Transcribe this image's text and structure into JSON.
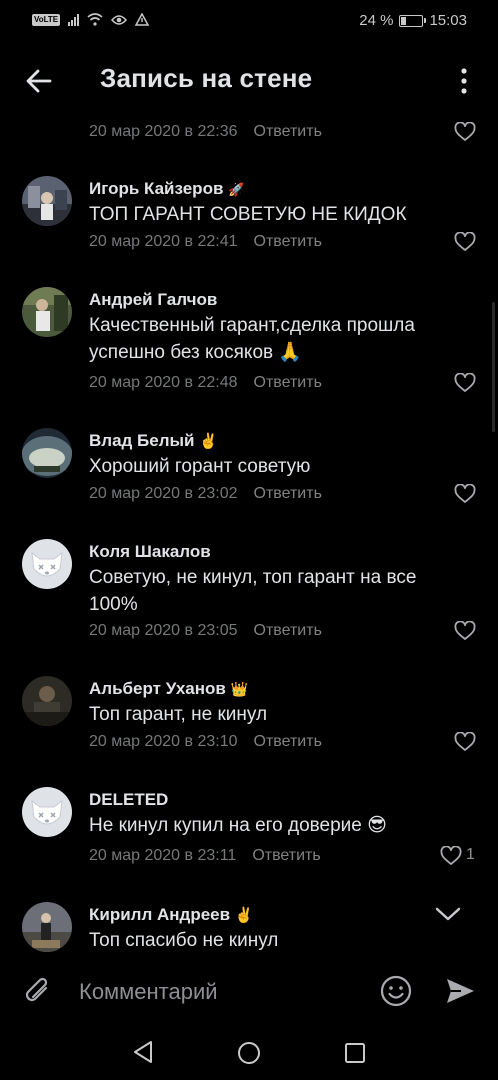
{
  "status_bar": {
    "volte": "VoLTE",
    "battery_text": "24 %",
    "battery_level": 0.24,
    "time": "15:03",
    "icons": [
      "signal-icon",
      "wifi-icon",
      "eye-icon",
      "alert-icon"
    ]
  },
  "header": {
    "title": "Запись на стене",
    "back_icon": "arrow-left-icon",
    "more_icon": "more-vertical-icon"
  },
  "reply_label": "Ответить",
  "comments": [
    {
      "author": "",
      "text": "",
      "date": "20 мар 2020 в 22:36",
      "likes": ""
    },
    {
      "author": "Игорь Кайзеров",
      "badge": "🚀",
      "text": "ТОП ГАРАНТ СОВЕТУЮ НЕ КИДОК",
      "date": "20 мар 2020 в 22:41",
      "likes": ""
    },
    {
      "author": "Андрей Галчов",
      "text": "Качественный гарант,сделка прошла успешно без косяков 🙏",
      "date": "20 мар 2020 в 22:48",
      "likes": ""
    },
    {
      "author": "Влад Белый",
      "badge": "✌️",
      "text": "Хороший горант советую",
      "date": "20 мар 2020 в 23:02",
      "likes": ""
    },
    {
      "author": "Коля Шакалов",
      "text": "Советую, не кинул, топ гарант на все 100%",
      "date": "20 мар 2020 в 23:05",
      "likes": ""
    },
    {
      "author": "Альберт Уханов",
      "badge": "👑",
      "text": "Топ гарант, не кинул",
      "date": "20 мар 2020 в 23:10",
      "likes": ""
    },
    {
      "author": "DELETED",
      "text": "Не кинул купил на его доверие 😎",
      "date": "20 мар 2020 в 23:11",
      "likes": "1"
    },
    {
      "author": "Кирилл Андреев",
      "badge": "✌️",
      "text": "Топ спасибо не кинул",
      "date": "",
      "likes": ""
    }
  ],
  "composer": {
    "placeholder": "Комментарий",
    "attach_icon": "paperclip-icon",
    "emoji_icon": "smile-icon",
    "send_icon": "send-icon"
  },
  "nav": [
    "nav-back-icon",
    "nav-home-icon",
    "nav-recent-icon"
  ],
  "colors": {
    "background": "#000000",
    "text_primary": "#e1e3e6",
    "text_secondary": "#76787a",
    "reply": "#828282",
    "icon": "#a9abae"
  }
}
